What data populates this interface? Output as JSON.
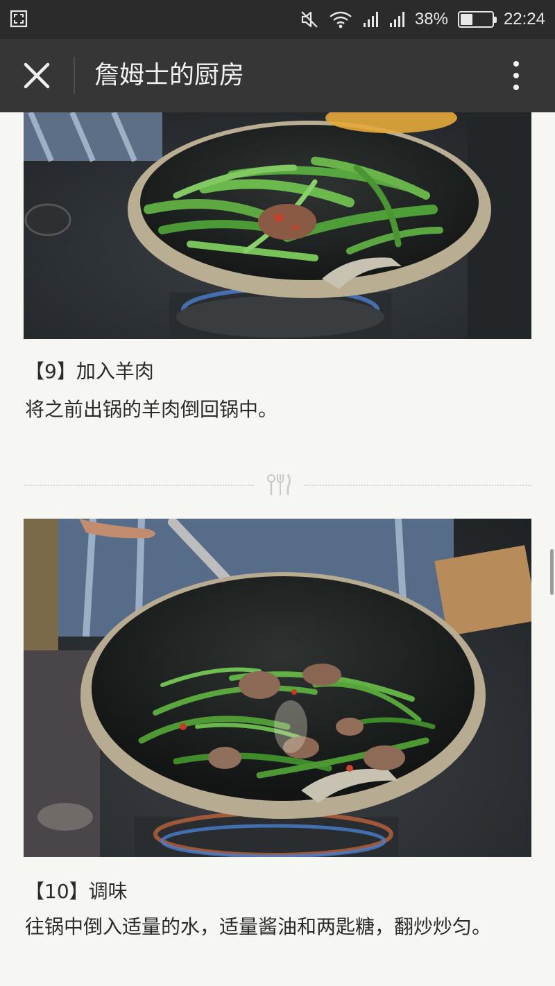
{
  "status_bar": {
    "battery": "38%",
    "battery_level": 0.38,
    "time": "22:24",
    "icons": [
      "screenshot-icon",
      "mute-icon",
      "wifi-icon",
      "signal-icon",
      "signal-icon",
      "battery-icon"
    ]
  },
  "app_bar": {
    "title": "詹姆士的厨房",
    "icons": [
      "close-icon",
      "more-vertical-icon"
    ]
  },
  "steps": [
    {
      "title": "【9】加入羊肉",
      "text": "将之前出锅的羊肉倒回锅中。"
    },
    {
      "title": "【10】调味",
      "text": "往锅中倒入适量的水，适量酱油和两匙糖，翻炒炒匀。"
    }
  ],
  "divider": {
    "icon": "cutlery-icon"
  },
  "colors": {
    "status_bar": "#2b2b2b",
    "app_bar": "#363636",
    "page_background": "#f6f7f2",
    "text": "#2a2a2a"
  }
}
